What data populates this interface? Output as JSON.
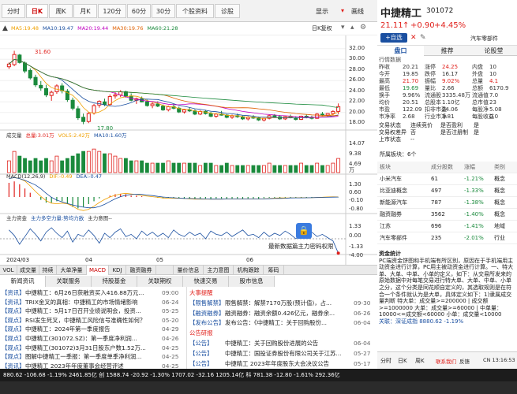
{
  "period_tabs": [
    "分时",
    "日K",
    "周K",
    "月K",
    "120分",
    "60分",
    "30分",
    "个股资料",
    "诊股"
  ],
  "top_right": {
    "display": "显示",
    "draw": "画线"
  },
  "stock": {
    "name": "中捷精工",
    "code": "301072",
    "price": "21.11",
    "arrow": "↑",
    "change": "+0.90",
    "pct": "+4.45%",
    "add_button": "+自选",
    "sector": "汽车零部件"
  },
  "right_tabs": [
    "盘口",
    "推荐",
    "论股堂"
  ],
  "quote_header": "行情数据",
  "quote_rows": [
    [
      "昨收",
      "20.21",
      "涨停",
      "24.25",
      "内盘",
      "10"
    ],
    [
      "今开",
      "19.85",
      "跌停",
      "16.17",
      "外盘",
      "10"
    ],
    [
      "最高",
      "21.70",
      "振幅",
      "9.02%",
      "总量",
      "4.1"
    ],
    [
      "最低",
      "19.69",
      "量比",
      "2.66",
      "总额",
      "6170.9"
    ],
    [
      "换手",
      "9.96%",
      "流通股",
      "3335.48万",
      "流通值",
      "7.0"
    ],
    [
      "均价",
      "20.51",
      "总股本",
      "1.10亿",
      "总市值",
      "23"
    ],
    [
      "市盈",
      "122.09",
      "扣非市盈",
      "24.06",
      "每股净",
      "5.08"
    ],
    [
      "市净率",
      "2.68",
      "行业市净",
      "1.81",
      "每股收益",
      "0.0"
    ]
  ],
  "extra_rows": [
    [
      "交易状态",
      "连续竞价",
      "是否盈利",
      "是"
    ],
    [
      "交易权差异",
      "否",
      "是否注册制",
      "是"
    ],
    [
      "上市状态",
      "--",
      "",
      ""
    ]
  ],
  "industry_header": "所属板块：6个",
  "industry_cols": [
    "板块",
    "成分股数",
    "涨幅",
    "类别"
  ],
  "industry_rows": [
    [
      "小米汽车",
      "61",
      "-1.21%",
      "概念"
    ],
    [
      "比亚迪概念",
      "497",
      "-1.33%",
      "概念"
    ],
    [
      "新能源汽车",
      "787",
      "-1.38%",
      "概念"
    ],
    [
      "融资融券",
      "3562",
      "-1.40%",
      "概念"
    ],
    [
      "江苏",
      "696",
      "-1.41%",
      "地域"
    ],
    [
      "汽车零部件",
      "235",
      "-2.01%",
      "行业"
    ]
  ],
  "fund_title": "资金统计",
  "fund_text": "PC端资金饼图和手机端有所区别，原因在于手机端用主动资金进行计算，PC用主被动资金进行计算。一、特大单、大单、中单、小单的定义，如下：从交易所发来的原始数据中对每笔交易进行特大单、大单、中单、小单之分，这个分类是同花顺自定义的，其选取规则是在符合一个条件就认为是大单，具体定义如下：1)隶属成交量判断 特大单：成交量>=200000 | 成交额>=1000000 大单：成交量>=60000 | 中单量：10000<=成交额<60000 小单：成交量<10000",
  "fund_foot": "关联：深证成指 8880.62 -1.19%",
  "fund_tabs": [
    "分时",
    "日K",
    "周K"
  ],
  "fund_buttons": [
    "联系我们",
    "反馈",
    "CN 13:16:53"
  ],
  "chart_legends": {
    "ma": [
      [
        "MA5:19.48",
        "#f0a000"
      ],
      [
        "MA10:19.47",
        "#1a4fa0"
      ],
      [
        "MA20:19.44",
        "#c000c0"
      ],
      [
        "MA30:19.76",
        "#e06000"
      ],
      [
        "MA60:21.28",
        "#1a8a3c"
      ]
    ],
    "vol": [
      [
        "成交量",
        ""
      ],
      [
        "总量:3.01万",
        "#e0211c"
      ],
      [
        "VOL5:2.42万",
        "#f0a000"
      ],
      [
        "MA10:1.60万",
        "#1a4fa0"
      ]
    ],
    "macd": [
      [
        "MACD(12,26,9)",
        ""
      ],
      [
        "DIF:-0.49",
        "#f0a000"
      ],
      [
        "DEA:-0.47",
        "#1a4fa0"
      ]
    ],
    "force": [
      [
        "主力资金",
        ""
      ],
      [
        "主力多空力量:势均力敌",
        "#1a4fa0"
      ],
      [
        "主力意图--",
        "#333"
      ]
    ]
  },
  "chart_label": "日K复权",
  "price_axis": [
    "32.00",
    "30.00",
    "28.00",
    "26.00",
    "24.00",
    "22.00",
    "20.00",
    "18.00"
  ],
  "vol_axis": [
    "14.07",
    "9.38",
    "4.69",
    "万"
  ],
  "macd_axis": [
    "1.30",
    "0.60",
    "-0.10",
    "-0.80"
  ],
  "force_axis": [
    "1.33",
    "0.00",
    "-1.33",
    "-4.00"
  ],
  "dates": [
    "2024/03",
    "04",
    "05",
    "06"
  ],
  "annotations": {
    "high": "31.60",
    "low": "17.80"
  },
  "banner": {
    "text": "最新数据篇主力密码权限",
    "icon": "lock-icon"
  },
  "subtabs": [
    "VOL",
    "成交量",
    "持续",
    "大单净量",
    "MACD",
    "KDJ",
    "融资融券",
    "",
    "量价信息",
    "主力意图",
    "机构跟踪",
    "筹码"
  ],
  "news_tabs": [
    "新闻资讯",
    "关联服务",
    "持股基金",
    "关联期权",
    "快速交易",
    "股市信息"
  ],
  "news_left": [
    [
      "【资讯】",
      "中捷精工：6月26日获融资买入416.88万元...",
      "09:00"
    ],
    [
      "【资讯】",
      "TRIX金叉的真相：中捷精工的市场情绪影响",
      "06-24"
    ],
    [
      "【观点】",
      "中捷精工：5月17日召开业绩说明会，投资...",
      "05-25"
    ],
    [
      "【观点】",
      "RSI发生死叉，中捷精工风险信号准确性如何？",
      "05-20"
    ],
    [
      "【观点】",
      "中捷精工：2024年第一季度报告",
      "04-29"
    ],
    [
      "【观点】",
      "中捷精工(301072.SZ)：第一季度净利润...",
      "04-26"
    ],
    [
      "【观点】",
      "中捷精工(301072)3月31日股东户数1.52万...",
      "04-25"
    ],
    [
      "【观点】",
      "图解中捷精工一季报：第一季度单季净利润...",
      "04-25"
    ],
    [
      "【资讯】",
      "中捷精工 2023年年度董事会经营评述",
      "04-25"
    ]
  ],
  "news_right": [
    [
      "大事提醒",
      "",
      "",
      ""
    ],
    [
      "【限售解禁】",
      "限售解禁：解禁7170万股(预计值)，占...",
      "09-30"
    ],
    [
      "【融资融券】",
      "融资融券：融资余额0.426亿元，融券余...",
      "06-26"
    ],
    [
      "【发布公告】",
      "发布公告：《中捷精工：关于回购股份...",
      "06-04"
    ],
    [
      "公告研报",
      "",
      "",
      ""
    ],
    [
      "【公告】",
      "中捷精工：关于回购股份进展的公告",
      "06-04"
    ],
    [
      "【公告】",
      "中捷精工：国投证券股份有限公司关于江苏...",
      "05-27"
    ],
    [
      "【公告】",
      "中捷精工 2023年年度股东大会决议公告",
      "05-17"
    ]
  ],
  "bottom_bar": "880.62 -106.68 -1.19%  2461.85亿  创 1588.74 -20.92 -1.30%  1707.02  -32.16  1205.14亿  科 781.38 -12.80 -1.61%  292.36亿",
  "colors": {
    "up": "#e0211c",
    "down": "#1a8a3c",
    "accent": "#1a4fa0"
  },
  "chart_data": {
    "type": "candlestick",
    "ylim": [
      17,
      33
    ],
    "y_ticks": [
      18,
      20,
      22,
      24,
      26,
      28,
      30,
      32
    ],
    "candles": [
      [
        28.6,
        29.4,
        28.2,
        29.1
      ],
      [
        29.0,
        31.6,
        28.7,
        30.9
      ],
      [
        30.8,
        31.0,
        29.2,
        29.4
      ],
      [
        29.3,
        29.6,
        27.4,
        27.8
      ],
      [
        27.9,
        28.3,
        26.2,
        26.5
      ],
      [
        26.6,
        27.1,
        24.8,
        25.2
      ],
      [
        25.1,
        25.9,
        24.1,
        24.6
      ],
      [
        24.5,
        25.2,
        22.9,
        23.3
      ],
      [
        23.2,
        24.1,
        22.2,
        23.8
      ],
      [
        23.9,
        25.3,
        23.5,
        25.0
      ],
      [
        25.0,
        25.5,
        23.6,
        24.1
      ],
      [
        24.0,
        24.4,
        22.0,
        22.4
      ],
      [
        22.3,
        22.8,
        20.4,
        20.8
      ],
      [
        20.7,
        21.2,
        18.6,
        19.0
      ],
      [
        19.1,
        19.8,
        17.8,
        18.3
      ],
      [
        18.3,
        20.1,
        18.0,
        19.8
      ],
      [
        19.9,
        21.6,
        19.6,
        21.3
      ],
      [
        21.4,
        22.3,
        20.9,
        22.1
      ],
      [
        22.0,
        22.6,
        21.2,
        21.5
      ],
      [
        21.5,
        23.4,
        21.3,
        23.0
      ],
      [
        23.1,
        23.9,
        22.6,
        23.3
      ],
      [
        23.3,
        24.2,
        22.9,
        23.9
      ],
      [
        23.9,
        24.1,
        22.8,
        23.1
      ],
      [
        23.1,
        23.6,
        22.1,
        22.3
      ],
      [
        22.3,
        22.8,
        21.6,
        22.6
      ],
      [
        22.6,
        23.0,
        21.9,
        22.0
      ],
      [
        22.0,
        22.4,
        21.1,
        21.3
      ],
      [
        21.3,
        21.9,
        20.8,
        21.6
      ],
      [
        21.6,
        22.1,
        21.0,
        21.2
      ],
      [
        21.2,
        21.5,
        20.3,
        20.5
      ],
      [
        20.5,
        21.3,
        20.2,
        21.1
      ],
      [
        21.1,
        21.6,
        20.6,
        20.8
      ],
      [
        20.8,
        21.1,
        19.9,
        20.1
      ],
      [
        20.1,
        20.7,
        19.8,
        20.5
      ],
      [
        20.5,
        21.0,
        20.1,
        20.3
      ],
      [
        20.3,
        20.6,
        19.5,
        19.7
      ],
      [
        19.7,
        20.4,
        19.5,
        20.2
      ],
      [
        20.2,
        20.5,
        19.6,
        19.8
      ],
      [
        19.8,
        20.1,
        19.1,
        19.3
      ],
      [
        19.3,
        19.9,
        19.0,
        19.7
      ],
      [
        19.7,
        20.3,
        19.4,
        19.5
      ],
      [
        19.5,
        19.7,
        18.9,
        19.1
      ],
      [
        19.1,
        19.6,
        18.8,
        19.4
      ],
      [
        19.4,
        19.8,
        19.0,
        19.2
      ],
      [
        19.2,
        19.4,
        18.6,
        18.8
      ],
      [
        18.8,
        19.3,
        18.5,
        19.1
      ],
      [
        19.1,
        19.5,
        18.8,
        19.0
      ],
      [
        19.0,
        19.2,
        18.4,
        18.6
      ],
      [
        18.6,
        19.0,
        18.3,
        18.9
      ],
      [
        18.9,
        19.6,
        18.7,
        19.4
      ],
      [
        19.4,
        19.7,
        19.0,
        19.2
      ],
      [
        19.2,
        19.5,
        18.6,
        18.8
      ],
      [
        18.8,
        19.3,
        18.6,
        19.2
      ],
      [
        19.2,
        19.6,
        18.9,
        19.0
      ],
      [
        19.0,
        19.3,
        18.5,
        18.7
      ],
      [
        18.7,
        19.4,
        18.6,
        19.3
      ],
      [
        19.3,
        19.6,
        18.9,
        19.1
      ],
      [
        19.1,
        19.4,
        18.7,
        18.9
      ],
      [
        18.9,
        19.9,
        18.8,
        19.7
      ],
      [
        19.7,
        20.1,
        19.3,
        19.5
      ],
      [
        19.5,
        19.9,
        19.1,
        19.8
      ],
      [
        19.8,
        20.4,
        19.5,
        20.2
      ],
      [
        20.2,
        21.7,
        19.7,
        21.1
      ]
    ],
    "volume": [
      5,
      9,
      7,
      6,
      5,
      6,
      5,
      6,
      5,
      7,
      5,
      6,
      7,
      8,
      9,
      9,
      10,
      9,
      8,
      8,
      7,
      6,
      6,
      5,
      5,
      5,
      4,
      4,
      4,
      4,
      5,
      4,
      4,
      4,
      4,
      4,
      3,
      4,
      4,
      3,
      3,
      4,
      3,
      3,
      3,
      3,
      3,
      3,
      3,
      4,
      3,
      3,
      3,
      3,
      3,
      4,
      3,
      3,
      4,
      3,
      3,
      4,
      6
    ],
    "macd": [
      1.0,
      1.1,
      0.9,
      0.6,
      0.3,
      0.0,
      -0.2,
      -0.4,
      -0.4,
      -0.3,
      -0.3,
      -0.5,
      -0.7,
      -0.8,
      -0.7,
      -0.5,
      -0.3,
      -0.1,
      0.0,
      0.1,
      0.2,
      0.2,
      0.2,
      0.1,
      0.1,
      0.05,
      0.0,
      0.0,
      -0.05,
      -0.1,
      -0.05,
      -0.05,
      -0.1,
      -0.1,
      -0.1,
      -0.15,
      -0.1,
      -0.1,
      -0.15,
      -0.1,
      -0.1,
      -0.12,
      -0.1,
      -0.1,
      -0.12,
      -0.1,
      -0.1,
      -0.12,
      -0.08,
      -0.05,
      -0.05,
      -0.06,
      -0.04,
      -0.04,
      -0.05,
      -0.03,
      -0.03,
      -0.04,
      0.0,
      0.0,
      0.01,
      0.02,
      -0.02
    ],
    "force": [
      0.8,
      0.3,
      -0.5,
      0.2,
      0.9,
      0.4,
      -0.2,
      0.6,
      1.0,
      0.5,
      0.1,
      0.7,
      -0.3,
      0.4,
      0.2,
      0.8,
      0.3,
      -0.4,
      0.5,
      0.1,
      0.6,
      0.9,
      0.2,
      0.4,
      0.0,
      0.7,
      0.3,
      0.6,
      0.2,
      0.5,
      0.1,
      0.8,
      0.4,
      0.2,
      0.6,
      0.3,
      0.5,
      0.0,
      0.7,
      0.4,
      0.3,
      0.6,
      0.2,
      0.5,
      0.8,
      0.3,
      0.4,
      0.1,
      0.6,
      0.2,
      0.5,
      0.3,
      0.7,
      0.4,
      0.0,
      0.5,
      0.3,
      0.6,
      0.2,
      0.4,
      0.1,
      -0.2,
      -1.3
    ]
  }
}
